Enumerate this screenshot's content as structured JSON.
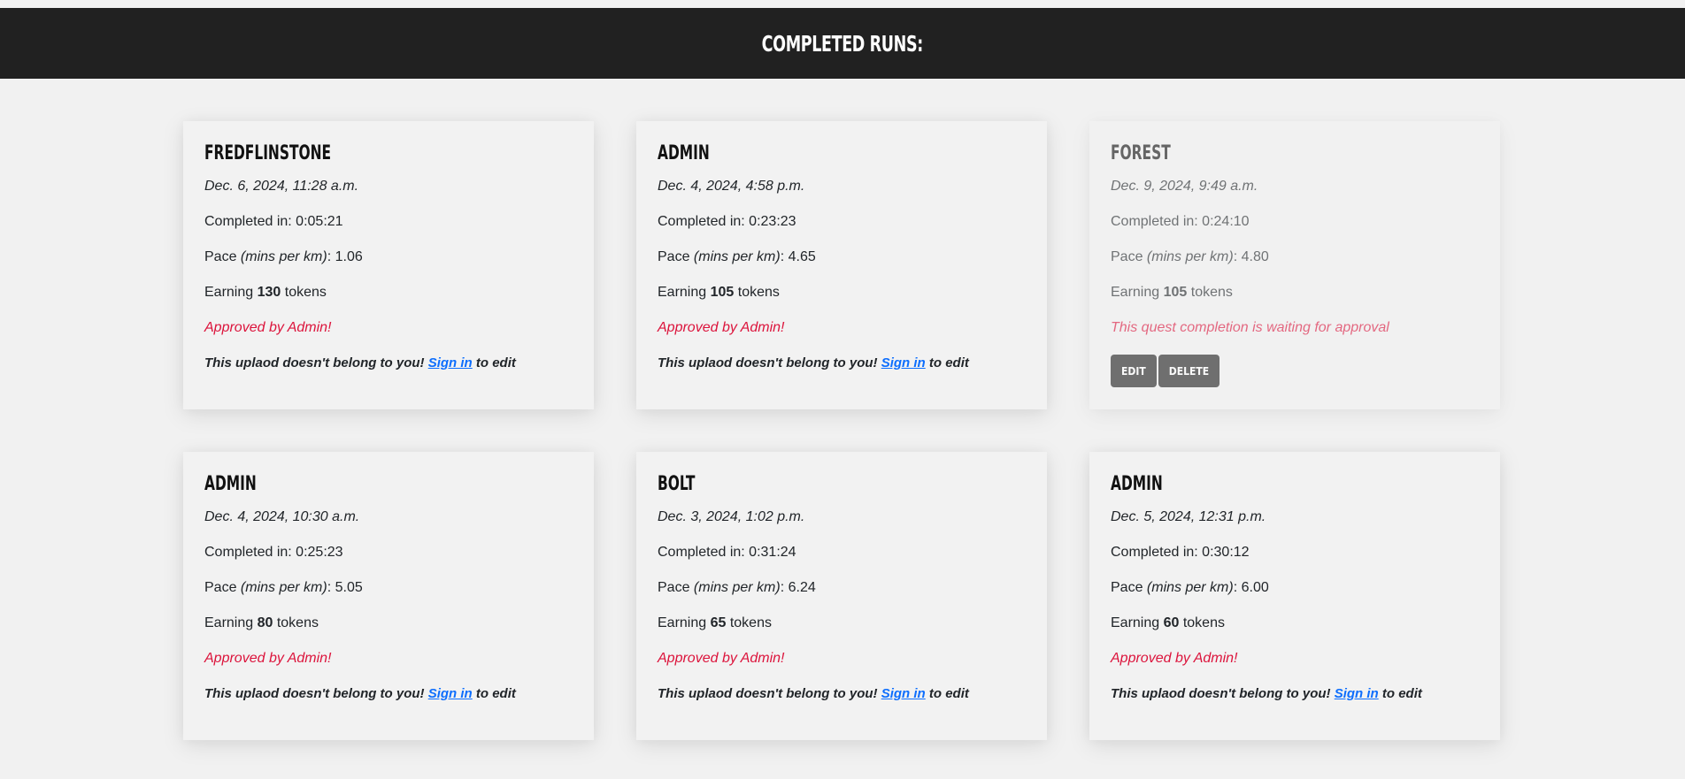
{
  "header": {
    "title": "COMPLETED RUNS:"
  },
  "runs": [
    {
      "user": "FREDFLINSTONE",
      "date": "Dec. 6, 2024, 11:28 a.m.",
      "completed_label": "Completed in: ",
      "completed_value": "0:05:21",
      "pace_label": "Pace ",
      "pace_unit": "(mins per km)",
      "pace_sep": ": ",
      "pace_value": "1.06",
      "earning_label": "Earning ",
      "tokens": "130",
      "tokens_suffix": " tokens",
      "status": "Approved by Admin!",
      "owner_prefix": "This uplaod doesn't belong to you! ",
      "owner_link": "Sign in",
      "owner_suffix": " to edit"
    },
    {
      "user": "ADMIN",
      "date": "Dec. 4, 2024, 4:58 p.m.",
      "completed_label": "Completed in: ",
      "completed_value": "0:23:23",
      "pace_label": "Pace ",
      "pace_unit": "(mins per km)",
      "pace_sep": ": ",
      "pace_value": "4.65",
      "earning_label": "Earning ",
      "tokens": "105",
      "tokens_suffix": " tokens",
      "status": "Approved by Admin!",
      "owner_prefix": "This uplaod doesn't belong to you! ",
      "owner_link": "Sign in",
      "owner_suffix": " to edit"
    },
    {
      "user": "FOREST",
      "date": "Dec. 9, 2024, 9:49 a.m.",
      "completed_label": "Completed in: ",
      "completed_value": "0:24:10",
      "pace_label": "Pace ",
      "pace_unit": "(mins per km)",
      "pace_sep": ": ",
      "pace_value": "4.80",
      "earning_label": "Earning ",
      "tokens": "105",
      "tokens_suffix": " tokens",
      "status": "This quest completion is waiting for approval",
      "edit_label": "EDIT",
      "delete_label": "DELETE"
    },
    {
      "user": "ADMIN",
      "date": "Dec. 4, 2024, 10:30 a.m.",
      "completed_label": "Completed in: ",
      "completed_value": "0:25:23",
      "pace_label": "Pace ",
      "pace_unit": "(mins per km)",
      "pace_sep": ": ",
      "pace_value": "5.05",
      "earning_label": "Earning ",
      "tokens": "80",
      "tokens_suffix": " tokens",
      "status": "Approved by Admin!",
      "owner_prefix": "This uplaod doesn't belong to you! ",
      "owner_link": "Sign in",
      "owner_suffix": " to edit"
    },
    {
      "user": "BOLT",
      "date": "Dec. 3, 2024, 1:02 p.m.",
      "completed_label": "Completed in: ",
      "completed_value": "0:31:24",
      "pace_label": "Pace ",
      "pace_unit": "(mins per km)",
      "pace_sep": ": ",
      "pace_value": "6.24",
      "earning_label": "Earning ",
      "tokens": "65",
      "tokens_suffix": " tokens",
      "status": "Approved by Admin!",
      "owner_prefix": "This uplaod doesn't belong to you! ",
      "owner_link": "Sign in",
      "owner_suffix": " to edit"
    },
    {
      "user": "ADMIN",
      "date": "Dec. 5, 2024, 12:31 p.m.",
      "completed_label": "Completed in: ",
      "completed_value": "0:30:12",
      "pace_label": "Pace ",
      "pace_unit": "(mins per km)",
      "pace_sep": ": ",
      "pace_value": "6.00",
      "earning_label": "Earning ",
      "tokens": "60",
      "tokens_suffix": " tokens",
      "status": "Approved by Admin!",
      "owner_prefix": "This uplaod doesn't belong to you! ",
      "owner_link": "Sign in",
      "owner_suffix": " to edit"
    }
  ]
}
